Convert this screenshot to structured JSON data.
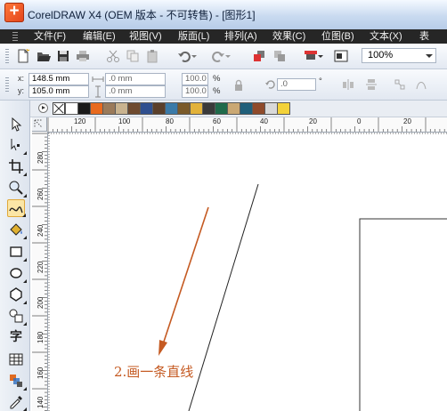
{
  "window": {
    "title": "CorelDRAW X4 (OEM 版本 - 不可转售) - [图形1]",
    "icon": "coreldraw-app-icon"
  },
  "menu": [
    {
      "label": "文件(F)"
    },
    {
      "label": "编辑(E)"
    },
    {
      "label": "视图(V)"
    },
    {
      "label": "版面(L)"
    },
    {
      "label": "排列(A)"
    },
    {
      "label": "效果(C)"
    },
    {
      "label": "位图(B)"
    },
    {
      "label": "文本(X)"
    },
    {
      "label": "表"
    }
  ],
  "toolbar": {
    "zoom": "100%"
  },
  "property_bar": {
    "x_label": "x:",
    "y_label": "y:",
    "x_value": "148.5 mm",
    "y_value": "105.0 mm",
    "width_value": ".0 mm",
    "height_value": ".0 mm",
    "scale_x": "100.0",
    "scale_y": "100.0",
    "percent": "%",
    "rotation": ".0"
  },
  "palette": {
    "colors": [
      "#ffffff",
      "#1a1a1a",
      "#e86a1e",
      "#9a7a5a",
      "#c9b38f",
      "#6e4a2f",
      "#2f4f8f",
      "#5a3f2b",
      "#3a7aa8",
      "#7a5a2a",
      "#e2b23a",
      "#3a3a3a",
      "#1f6a4a",
      "#caa874",
      "#205f7a",
      "#8f4a2a",
      "#d9d9d9",
      "#f3d23a"
    ]
  },
  "ruler": {
    "top_labels": [
      "120",
      "100",
      "80",
      "60",
      "40",
      "20",
      "0",
      "20"
    ],
    "left_labels": [
      "280",
      "260",
      "240",
      "220",
      "200",
      "180",
      "160",
      "140"
    ]
  },
  "toolbox": {
    "text_tool_glyph": "字"
  },
  "annotation": {
    "text": "2.画一条直线"
  },
  "colors": {
    "title_bar": "#c9daf0",
    "menu_bar": "#262626",
    "annotation": "#c55a22"
  }
}
